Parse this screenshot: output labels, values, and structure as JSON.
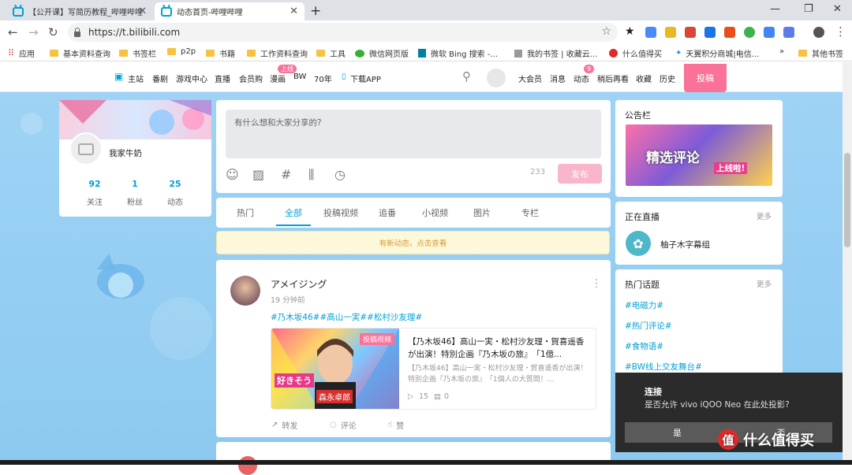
{
  "browser": {
    "tabs": [
      {
        "title": "【公开课】写简历教程_哔哩哔哩",
        "active": false
      },
      {
        "title": "动态首页-哔哩哔哩",
        "active": true
      }
    ],
    "url": "https://t.bilibili.com",
    "bookmarks": [
      "应用",
      "基本资料查询",
      "书签栏",
      "p2p",
      "书籍",
      "工作资料查询",
      "工具",
      "微信网页版",
      "微软 Bing 搜索 -...",
      "我的书签 | 收藏云...",
      "什么值得买",
      "天翼积分商城|电信...",
      "»",
      "其他书签"
    ]
  },
  "site_nav": {
    "left": [
      "主站",
      "番剧",
      "游戏中心",
      "直播",
      "会员购",
      "漫画",
      "BW",
      "70年",
      "下载APP"
    ],
    "manga_badge": "上线",
    "right": [
      "大会员",
      "消息",
      "动态",
      "稍后再看",
      "收藏",
      "历史"
    ],
    "dynamic_count": "9",
    "upload_label": "投稿"
  },
  "profile": {
    "name": "我家牛奶",
    "stats": [
      {
        "value": "92",
        "label": "关注"
      },
      {
        "value": "1",
        "label": "粉丝"
      },
      {
        "value": "25",
        "label": "动态"
      }
    ]
  },
  "composer": {
    "placeholder": "有什么想和大家分享的?",
    "char_count": "233",
    "post_label": "发布"
  },
  "feed_tabs": [
    "热门",
    "全部",
    "投稿视频",
    "追番",
    "小视频",
    "图片",
    "专栏"
  ],
  "feed_active_tab": "全部",
  "notice": "有新动态，点击查看",
  "post": {
    "author": "アメイジング",
    "time": "19 分钟前",
    "tags": "#乃木坂46##高山一実##松村沙友理#",
    "video": {
      "badge": "投稿视频",
      "title": "【乃木坂46】高山一実・松村沙友理・賀喜遥香が出演！特別企画『乃木坂の旅』　「1億...",
      "desc": "【乃木坂46】高山一実・松村沙友理・賀喜遥香が出演！特別企画『乃木坂の旅』　「1個人の大質問！...",
      "plays": "15",
      "comments": "0",
      "thumb_caption": "好きそう",
      "thumb_name": "森永卓郎"
    },
    "actions": [
      "转发",
      "评论",
      "赞"
    ]
  },
  "sidebar": {
    "notice_title": "公告栏",
    "notice_banner": "精选评论",
    "notice_banner_sub": "上线啦!",
    "live_title": "正在直播",
    "live_more": "更多",
    "live_item": "柚子木字幕组",
    "topics_title": "热门话题",
    "topics_more": "更多",
    "topics": [
      "#电磁力#",
      "#热门评论#",
      "#食物语#",
      "#BW线上交友舞台#"
    ]
  },
  "dialog": {
    "title": "连接",
    "message": "是否允许 vivo iQOO Neo 在此处投影?",
    "yes": "是",
    "no": "否"
  },
  "watermark": "值 什么值得买",
  "colors": {
    "accent": "#00a1d6",
    "pink": "#fb7299"
  }
}
